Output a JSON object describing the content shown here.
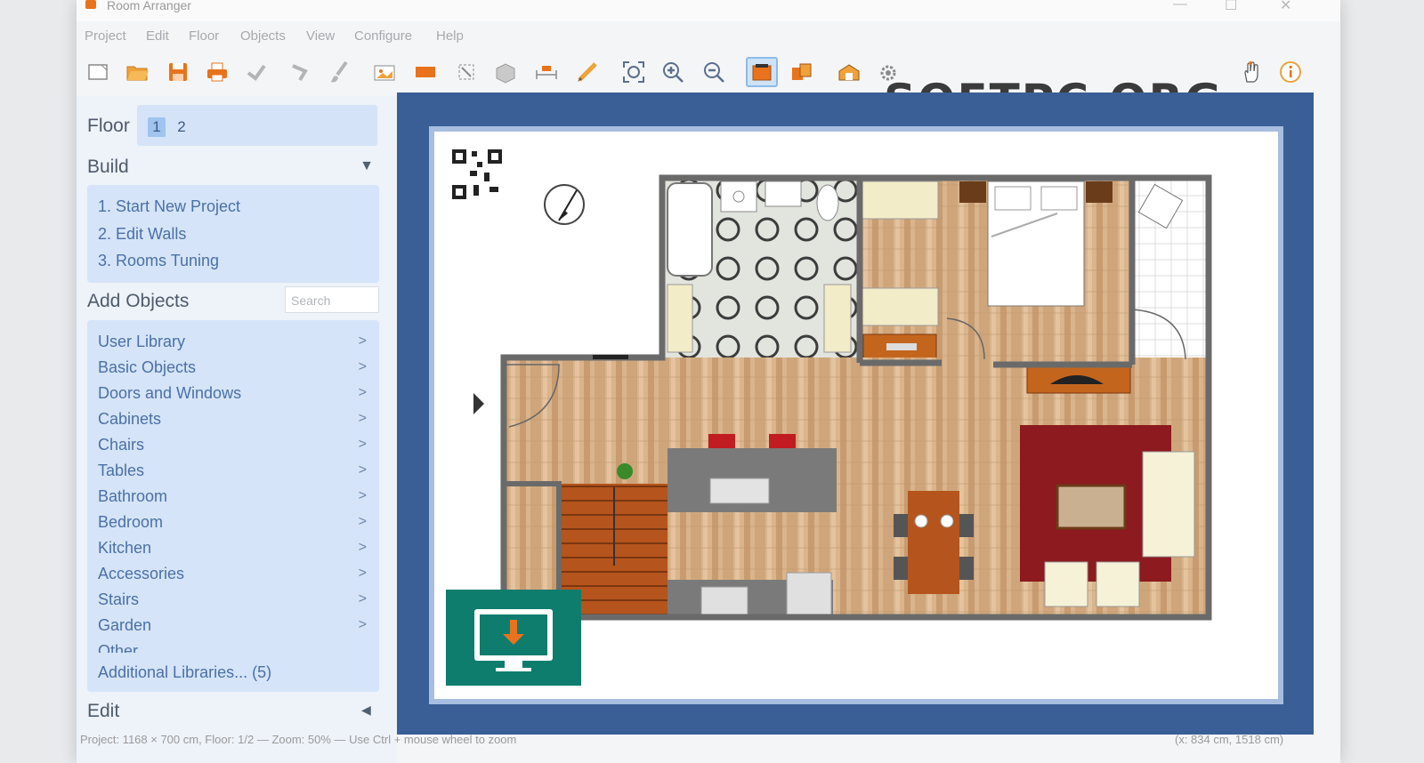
{
  "app": {
    "title": "Room Arranger"
  },
  "window_controls": [
    "—",
    "☐",
    "✕"
  ],
  "menu": [
    "Project",
    "Edit",
    "Floor",
    "Objects",
    "View",
    "Configure",
    "Help"
  ],
  "watermark": "SOFTPC.ORG",
  "toolbar": {
    "icons": [
      "new-document-icon",
      "open-folder-icon",
      "save-icon",
      "print-icon",
      "undo-icon",
      "redo-icon",
      "paint-brush-icon",
      "add-image-icon",
      "rectangle-icon",
      "select-icon",
      "3d-box-icon",
      "dimension-icon",
      "pencil-icon",
      "zoom-fit-icon",
      "zoom-in-icon",
      "zoom-out-icon",
      "2d-view-icon",
      "objects-view-icon",
      "3d-view-icon",
      "settings-icon",
      "hand-pan-icon",
      "info-icon"
    ],
    "active": "2d-view-icon",
    "accent": "#e8731c"
  },
  "sidebar": {
    "floor": {
      "label": "Floor",
      "tabs": [
        "1",
        "2"
      ],
      "selected": "1"
    },
    "build": {
      "label": "Build",
      "items": [
        "1. Start New Project",
        "2. Edit Walls",
        "3. Rooms Tuning"
      ]
    },
    "add_objects": {
      "label": "Add Objects",
      "search_placeholder": "Search",
      "items": [
        "User Library",
        "Basic Objects",
        "Doors and Windows",
        "Cabinets",
        "Chairs",
        "Tables",
        "Bathroom",
        "Bedroom",
        "Kitchen",
        "Accessories",
        "Stairs",
        "Garden",
        "Other"
      ],
      "additional": "Additional Libraries... (5)"
    },
    "edit": {
      "label": "Edit"
    }
  },
  "status": {
    "left": "Project: 1168 × 700 cm, Floor: 1/2 — Zoom: 50% — Use Ctrl + mouse wheel to zoom",
    "right": "(x: 834 cm, 1518 cm)"
  },
  "colors": {
    "canvas_bg": "#3a5f96",
    "floor_wood": "#d9b48c",
    "rug": "#8c1a1e",
    "wall": "#6a6a6a",
    "badge": "#0e7d6e"
  }
}
